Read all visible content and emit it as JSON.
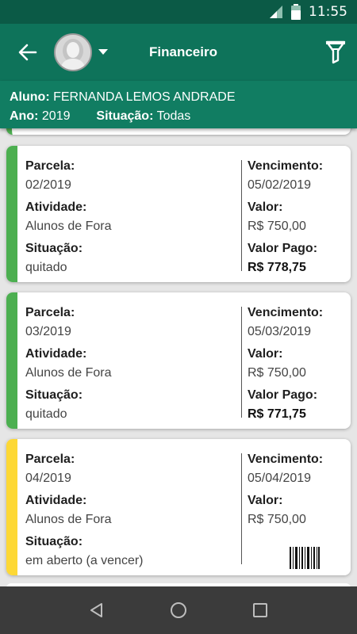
{
  "status_bar": {
    "time": "11:55"
  },
  "app_bar": {
    "title": "Financeiro"
  },
  "info": {
    "aluno_label": "Aluno:",
    "aluno_value": "FERNANDA LEMOS ANDRADE",
    "ano_label": "Ano:",
    "ano_value": "2019",
    "situacao_label": "Situação:",
    "situacao_value": "Todas"
  },
  "labels": {
    "parcela": "Parcela:",
    "atividade": "Atividade:",
    "situacao": "Situação:",
    "vencimento": "Vencimento:",
    "valor": "Valor:",
    "valor_pago": "Valor Pago:"
  },
  "colors": {
    "paid": "#4caf50",
    "open": "#fdd835",
    "primary": "#0e735a"
  },
  "items": [
    {
      "parcela": "02/2019",
      "atividade": "Alunos de Fora",
      "situacao": "quitado",
      "vencimento": "05/02/2019",
      "valor": "R$ 750,00",
      "valor_pago": "R$ 778,75",
      "status": "paid"
    },
    {
      "parcela": "03/2019",
      "atividade": "Alunos de Fora",
      "situacao": "quitado",
      "vencimento": "05/03/2019",
      "valor": "R$ 750,00",
      "valor_pago": "R$ 771,75",
      "status": "paid"
    },
    {
      "parcela": "04/2019",
      "atividade": "Alunos de Fora",
      "situacao": "em aberto (a vencer)",
      "vencimento": "05/04/2019",
      "valor": "R$ 750,00",
      "status": "open",
      "icon": "barcode-icon"
    }
  ]
}
